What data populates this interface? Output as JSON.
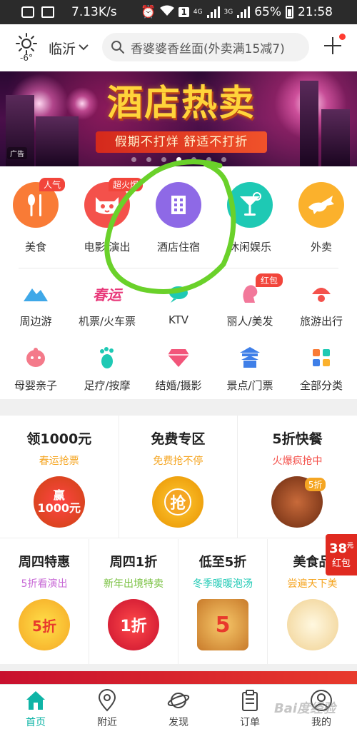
{
  "status_bar": {
    "network_speed": "7.13K/s",
    "sim_badge": "1",
    "net_4g": "4G",
    "net_3g": "3G",
    "battery": "65%",
    "time": "21:58"
  },
  "header": {
    "temperature": "-6°",
    "city": "临沂",
    "search_placeholder": "香婆婆香丝面(外卖满15减7)"
  },
  "banner": {
    "title": "酒店热卖",
    "subtitle": "假期不打烊 舒适不打折",
    "ad_tag": "广告",
    "slide_count": 7,
    "active_slide": 4
  },
  "primary_categories": [
    {
      "label": "美食",
      "badge": "人气",
      "color": "#f97b36"
    },
    {
      "label": "电影/演出",
      "badge": "超火爆",
      "color": "#f4514b"
    },
    {
      "label": "酒店住宿",
      "badge": "",
      "color": "#8e69e6"
    },
    {
      "label": "休闲娱乐",
      "badge": "",
      "color": "#1ec9b4"
    },
    {
      "label": "外卖",
      "badge": "",
      "color": "#fbb12c"
    }
  ],
  "secondary_categories": [
    {
      "label": "周边游",
      "badge": ""
    },
    {
      "label": "机票/火车票",
      "badge": "",
      "icon_text": "春运"
    },
    {
      "label": "KTV",
      "badge": ""
    },
    {
      "label": "丽人/美发",
      "badge": "红包"
    },
    {
      "label": "旅游出行",
      "badge": ""
    },
    {
      "label": "母婴亲子",
      "badge": ""
    },
    {
      "label": "足疗/按摩",
      "badge": ""
    },
    {
      "label": "结婚/摄影",
      "badge": ""
    },
    {
      "label": "景点/门票",
      "badge": ""
    },
    {
      "label": "全部分类",
      "badge": ""
    }
  ],
  "deals_row1": [
    {
      "title": "领1000元",
      "subtitle": "春运抢票",
      "sub_color": "#f5a623",
      "img_text": "赢\n1000元"
    },
    {
      "title": "免费专区",
      "subtitle": "免费抢不停",
      "sub_color": "#f5a623",
      "img_text": "抢"
    },
    {
      "title": "5折快餐",
      "subtitle": "火爆疯抢中",
      "sub_color": "#f4514b",
      "img_text": "5折"
    }
  ],
  "deals_row2": [
    {
      "title": "周四特惠",
      "subtitle": "5折看演出",
      "sub_color": "#c86ad6",
      "img_text": "5折"
    },
    {
      "title": "周四1折",
      "subtitle": "新年出境特卖",
      "sub_color": "#7ac142",
      "img_text": "1折"
    },
    {
      "title": "低至5折",
      "subtitle": "冬季暖暖泡汤",
      "sub_color": "#1ec9b4",
      "img_text": "5"
    },
    {
      "title": "美食品",
      "subtitle": "尝遍天下美",
      "sub_color": "#f5a623",
      "img_text": ""
    }
  ],
  "floating_redpacket": {
    "amount": "38",
    "unit": "元",
    "label": "红包"
  },
  "tabbar": [
    {
      "label": "首页",
      "active": true
    },
    {
      "label": "附近",
      "active": false
    },
    {
      "label": "发现",
      "active": false
    },
    {
      "label": "订单",
      "active": false
    },
    {
      "label": "我的",
      "active": false
    }
  ],
  "watermark": "Bai度经验",
  "colors": {
    "accent": "#0fb4a6",
    "annotation": "#6ad12a"
  }
}
